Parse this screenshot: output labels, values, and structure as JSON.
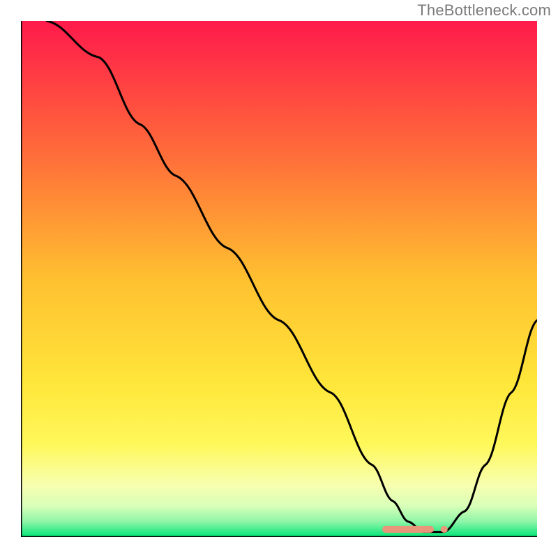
{
  "attribution": "TheBottleneck.com",
  "chart_data": {
    "type": "line",
    "title": "",
    "xlabel": "",
    "ylabel": "",
    "xlim": [
      0,
      100
    ],
    "ylim": [
      0,
      100
    ],
    "background_gradient": {
      "stops": [
        {
          "offset": 0.0,
          "color": "#ff1a4b"
        },
        {
          "offset": 0.25,
          "color": "#ff6a3a"
        },
        {
          "offset": 0.5,
          "color": "#ffc030"
        },
        {
          "offset": 0.7,
          "color": "#ffe63a"
        },
        {
          "offset": 0.82,
          "color": "#fff85a"
        },
        {
          "offset": 0.9,
          "color": "#f7ffb0"
        },
        {
          "offset": 0.94,
          "color": "#d8ffb8"
        },
        {
          "offset": 0.97,
          "color": "#8ef5a8"
        },
        {
          "offset": 1.0,
          "color": "#00e676"
        }
      ]
    },
    "series": [
      {
        "name": "bottleneck-curve",
        "color": "#000000",
        "x": [
          5,
          15,
          23,
          30,
          40,
          50,
          60,
          68,
          72,
          75,
          78,
          82,
          86,
          90,
          95,
          100
        ],
        "y": [
          100,
          93,
          80,
          70,
          56,
          42,
          28,
          14,
          7,
          3,
          1,
          1,
          5,
          14,
          28,
          42
        ]
      }
    ],
    "markers": {
      "name": "optimal-range",
      "color": "#e9967a",
      "shape": "rounded-bar-with-dot",
      "x_start": 70,
      "x_end": 80,
      "dot_x": 82,
      "y": 1.5
    }
  }
}
